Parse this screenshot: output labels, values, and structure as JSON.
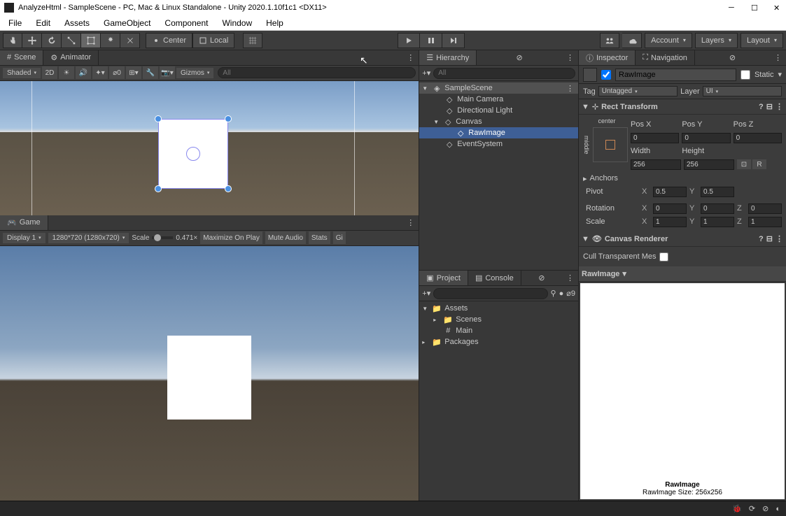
{
  "titlebar": {
    "title": "AnalyzeHtml - SampleScene - PC, Mac & Linux Standalone - Unity 2020.1.10f1c1 <DX11>"
  },
  "menubar": [
    "File",
    "Edit",
    "Assets",
    "GameObject",
    "Component",
    "Window",
    "Help"
  ],
  "toolbar": {
    "pivot_center": "Center",
    "pivot_local": "Local",
    "account": "Account",
    "layers": "Layers",
    "layout": "Layout"
  },
  "scene_tab": {
    "scene": "Scene",
    "animator": "Animator",
    "shading": "Shaded",
    "mode_2d": "2D",
    "gizmos": "Gizmos",
    "search_ph": "All",
    "ratio": "⌀0"
  },
  "game_tab": {
    "game": "Game",
    "display": "Display 1",
    "resolution": "1280*720 (1280x720)",
    "scale_label": "Scale",
    "scale_value": "0.471×",
    "maximize": "Maximize On Play",
    "mute": "Mute Audio",
    "stats": "Stats",
    "gi": "Gi"
  },
  "hierarchy": {
    "title": "Hierarchy",
    "search_ph": "All",
    "scene_name": "SampleScene",
    "items": [
      "Main Camera",
      "Directional Light",
      "Canvas",
      "RawImage",
      "EventSystem"
    ]
  },
  "project": {
    "project": "Project",
    "console": "Console",
    "search_ph": "",
    "icon_count": "9",
    "assets": "Assets",
    "scenes": "Scenes",
    "main": "Main",
    "packages": "Packages"
  },
  "inspector": {
    "inspector": "Inspector",
    "navigation": "Navigation",
    "object_name": "RawImage",
    "static": "Static",
    "tag_label": "Tag",
    "tag_value": "Untagged",
    "layer_label": "Layer",
    "layer_value": "UI",
    "rect_transform": {
      "title": "Rect Transform",
      "anchor_label": "center",
      "anchor_side": "middle",
      "posx_label": "Pos X",
      "posy_label": "Pos Y",
      "posz_label": "Pos Z",
      "posx": "0",
      "posy": "0",
      "posz": "0",
      "width_label": "Width",
      "height_label": "Height",
      "width": "256",
      "height": "256",
      "anchors": "Anchors",
      "pivot": "Pivot",
      "pivot_x": "0.5",
      "pivot_y": "0.5",
      "rotation": "Rotation",
      "rot_x": "0",
      "rot_y": "0",
      "rot_z": "0",
      "scale": "Scale",
      "scale_x": "1",
      "scale_y": "1",
      "scale_z": "1"
    },
    "canvas_renderer": {
      "title": "Canvas Renderer",
      "cull": "Cull Transparent Mes"
    },
    "rawimage": {
      "title": "RawImage",
      "preview_name": "RawImage",
      "preview_size": "RawImage Size: 256x256"
    }
  }
}
